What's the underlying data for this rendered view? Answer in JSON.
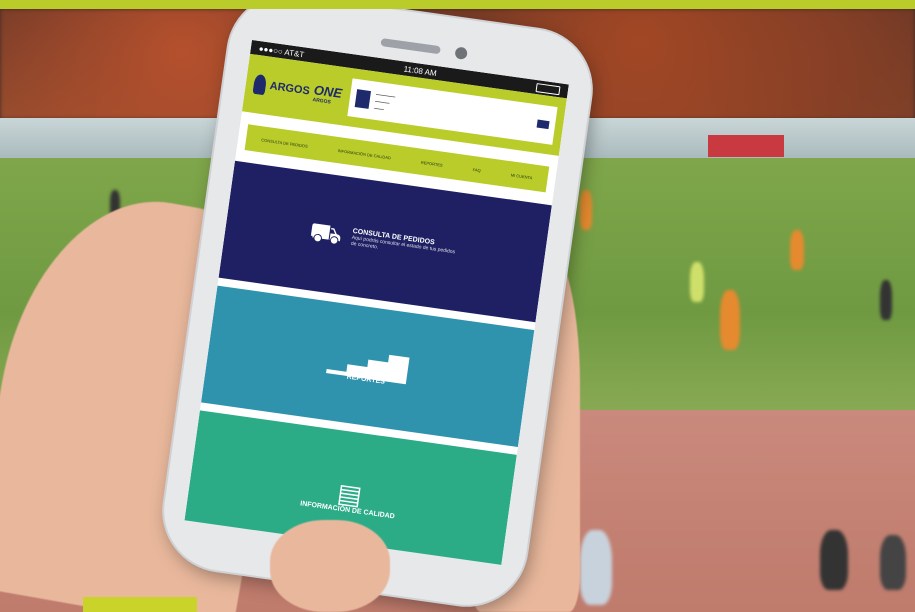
{
  "status_bar": {
    "carrier": "●●●○○ AT&T",
    "time": "11:08 AM"
  },
  "brand": {
    "name": "ARGOS",
    "product": "ONE",
    "sub": "ARGOS"
  },
  "nav": {
    "items": [
      "CONSULTA DE PEDIDOS",
      "INFORMACIÓN DE CALIDAD",
      "REPORTES",
      "FAQ",
      "MI CUENTA"
    ]
  },
  "tiles": [
    {
      "title": "CONSULTA DE PEDIDOS",
      "desc": "Aquí podrás consultar el estado de tus pedidos de concreto.",
      "icon": "mixer-truck-icon",
      "color": "#1e2063"
    },
    {
      "title": "REPORTES",
      "icon": "bar-chart-icon",
      "color": "#2f93ae"
    },
    {
      "title": "INFORMACIÓN DE CALIDAD",
      "icon": "document-icon",
      "color": "#2bac87"
    }
  ],
  "colors": {
    "accent": "#b9cc2a",
    "navy": "#1e2063"
  }
}
